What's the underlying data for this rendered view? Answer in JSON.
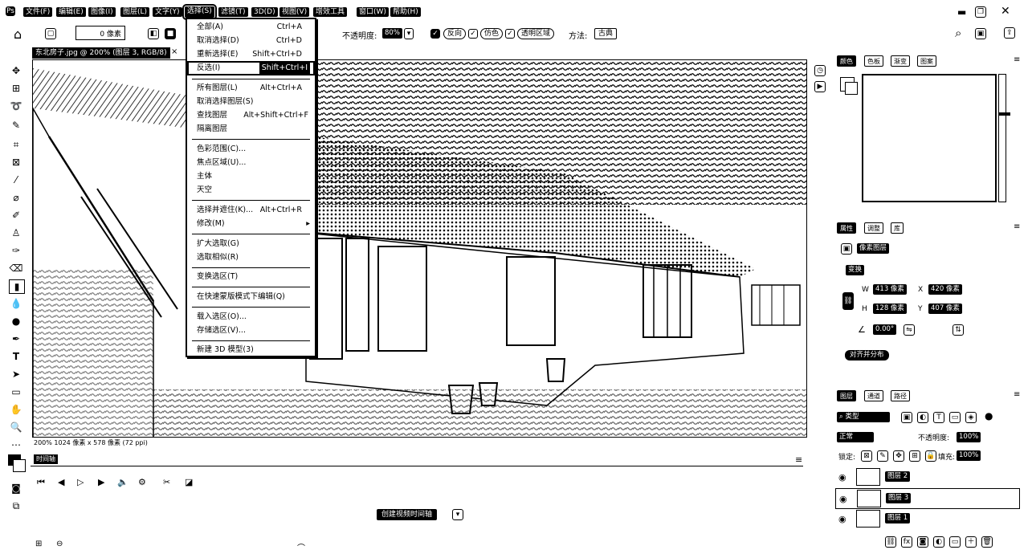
{
  "menubar": {
    "app_icon": "app-logo-icon",
    "items": [
      {
        "label": "文件(F)"
      },
      {
        "label": "编辑(E)"
      },
      {
        "label": "图像(I)"
      },
      {
        "label": "图层(L)"
      },
      {
        "label": "文字(Y)"
      },
      {
        "label": "选择(S)"
      },
      {
        "label": "滤镜(T)"
      },
      {
        "label": "3D(D)"
      },
      {
        "label": "视图(V)"
      },
      {
        "label": "增效工具"
      },
      {
        "label": "窗口(W)"
      },
      {
        "label": "帮助(H)"
      }
    ],
    "window_controls": [
      "minimize-icon",
      "restore-icon",
      "close-icon"
    ]
  },
  "optionbar": {
    "size_value": "0 像素",
    "opacity_label": "不透明度:",
    "opacity_value": "80%",
    "reverse_label": "反向",
    "dither_label": "仿色",
    "transparency_label": "透明区域",
    "method_label": "方法:",
    "method_value": "古典"
  },
  "document": {
    "tab_title": "东北房子.jpg @ 200% (图层 3, RGB/8)",
    "status": "200%    1024 像素 x 578 像素 (72 ppi)"
  },
  "select_menu": {
    "items": [
      {
        "label": "全部(A)",
        "shortcut": "Ctrl+A"
      },
      {
        "label": "取消选择(D)",
        "shortcut": "Ctrl+D"
      },
      {
        "label": "重新选择(E)",
        "shortcut": "Shift+Ctrl+D"
      },
      {
        "label": "反选(I)",
        "shortcut": "Shift+Ctrl+I"
      },
      {
        "label": "所有图层(L)",
        "shortcut": "Alt+Ctrl+A"
      },
      {
        "label": "取消选择图层(S)",
        "shortcut": ""
      },
      {
        "label": "查找图层",
        "shortcut": "Alt+Shift+Ctrl+F"
      },
      {
        "label": "隔离图层",
        "shortcut": ""
      },
      {
        "label": "色彩范围(C)...",
        "shortcut": ""
      },
      {
        "label": "焦点区域(U)...",
        "shortcut": ""
      },
      {
        "label": "主体",
        "shortcut": ""
      },
      {
        "label": "天空",
        "shortcut": ""
      },
      {
        "label": "选择并遮住(K)...",
        "shortcut": "Alt+Ctrl+R"
      },
      {
        "label": "修改(M)",
        "shortcut": "▸"
      },
      {
        "label": "扩大选取(G)",
        "shortcut": ""
      },
      {
        "label": "选取相似(R)",
        "shortcut": ""
      },
      {
        "label": "变换选区(T)",
        "shortcut": ""
      },
      {
        "label": "在快速蒙版模式下编辑(Q)",
        "shortcut": ""
      },
      {
        "label": "载入选区(O)...",
        "shortcut": ""
      },
      {
        "label": "存储选区(V)...",
        "shortcut": ""
      },
      {
        "label": "新建 3D 模型(3)",
        "shortcut": ""
      }
    ]
  },
  "timeline": {
    "tab_label": "时间轴",
    "create_button": "创建视频时间轴"
  },
  "color_panel": {
    "tabs": [
      "颜色",
      "色板",
      "渐变",
      "图案"
    ]
  },
  "properties_panel": {
    "tabs": [
      "属性",
      "调整",
      "库"
    ],
    "header": "像素图层",
    "section": "变换",
    "w_label": "W",
    "w_value": "413 像素",
    "x_label": "X",
    "x_value": "420 像素",
    "h_label": "H",
    "h_value": "128 像素",
    "y_value": "407 像素",
    "angle_value": "0.00°",
    "align_button": "对齐并分布"
  },
  "layers_panel": {
    "tabs": [
      "图层",
      "通道",
      "路径"
    ],
    "filter_label": "类型",
    "blend_mode": "正常",
    "opacity_label": "不透明度:",
    "opacity_value": "100%",
    "lock_label": "锁定:",
    "fill_label": "填充:",
    "fill_value": "100%",
    "layers": [
      {
        "name": "图层 2"
      },
      {
        "name": "图层 3"
      },
      {
        "name": "图层 1"
      }
    ]
  },
  "colors": {
    "ink": "#000000",
    "paper": "#ffffff"
  }
}
